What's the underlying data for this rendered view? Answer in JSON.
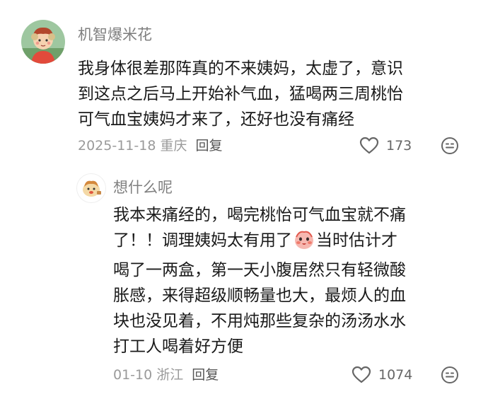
{
  "comment": {
    "username": "机智爆米花",
    "lines": [
      "我身体很差那阵真的不来姨妈，太虚了，意识",
      "到这点之后马上开始补气血，猛喝两三周桃怡",
      "可气血宝姨妈才来了，还好也没有痛经"
    ],
    "date_location": "2025-11-18 重庆",
    "reply_label": "回复",
    "like_count": "173",
    "like_icon": "heart-outline-icon",
    "emoji_icon": "emoji-face-icon"
  },
  "reply": {
    "username": "想什么呢",
    "lines": [
      "我本来痛经的，喝完桃怡可气血宝就不痛",
      {
        "before": "了！！调理姨妈太有用了",
        "after": "当时估计才"
      },
      "喝了一两盒，第一天小腹居然只有轻微酸",
      "胀感，来得超级顺畅量也大，最烦人的血",
      "块也没见着，不用炖那些复杂的汤汤水水",
      "打工人喝着好方便"
    ],
    "inline_emoji": "blush-face-emoji",
    "date_location": "01-10 浙江",
    "reply_label": "回复",
    "like_count": "1074",
    "like_icon": "heart-outline-icon",
    "emoji_icon": "emoji-face-icon"
  },
  "colors": {
    "username": "#7f7f7f",
    "text": "#1a1a1a",
    "meta": "#9a9a9a",
    "icon": "#666666"
  }
}
